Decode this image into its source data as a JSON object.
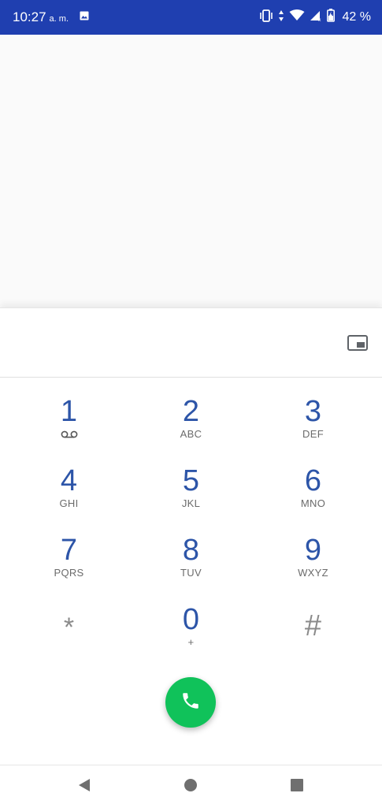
{
  "status_bar": {
    "time": "10:27",
    "ampm": "a. m.",
    "battery": "42 %",
    "icons": [
      "image-icon",
      "vibrate-icon",
      "data-arrows-icon",
      "wifi-icon",
      "signal-icon",
      "battery-icon"
    ],
    "bg_color": "#1f3fb0"
  },
  "keypad": {
    "keys": [
      {
        "digit": "1",
        "sub": ""
      },
      {
        "digit": "2",
        "sub": "ABC"
      },
      {
        "digit": "3",
        "sub": "DEF"
      },
      {
        "digit": "4",
        "sub": "GHI"
      },
      {
        "digit": "5",
        "sub": "JKL"
      },
      {
        "digit": "6",
        "sub": "MNO"
      },
      {
        "digit": "7",
        "sub": "PQRS"
      },
      {
        "digit": "8",
        "sub": "TUV"
      },
      {
        "digit": "9",
        "sub": "WXYZ"
      },
      {
        "digit": "*",
        "sub": ""
      },
      {
        "digit": "0",
        "sub": "+"
      },
      {
        "digit": "#",
        "sub": ""
      }
    ],
    "digit_color": "#2d55a8"
  },
  "call_button": {
    "icon": "phone-icon",
    "color": "#10c25a"
  },
  "nav": {
    "icons": [
      "back-icon",
      "home-icon",
      "recents-icon"
    ]
  }
}
